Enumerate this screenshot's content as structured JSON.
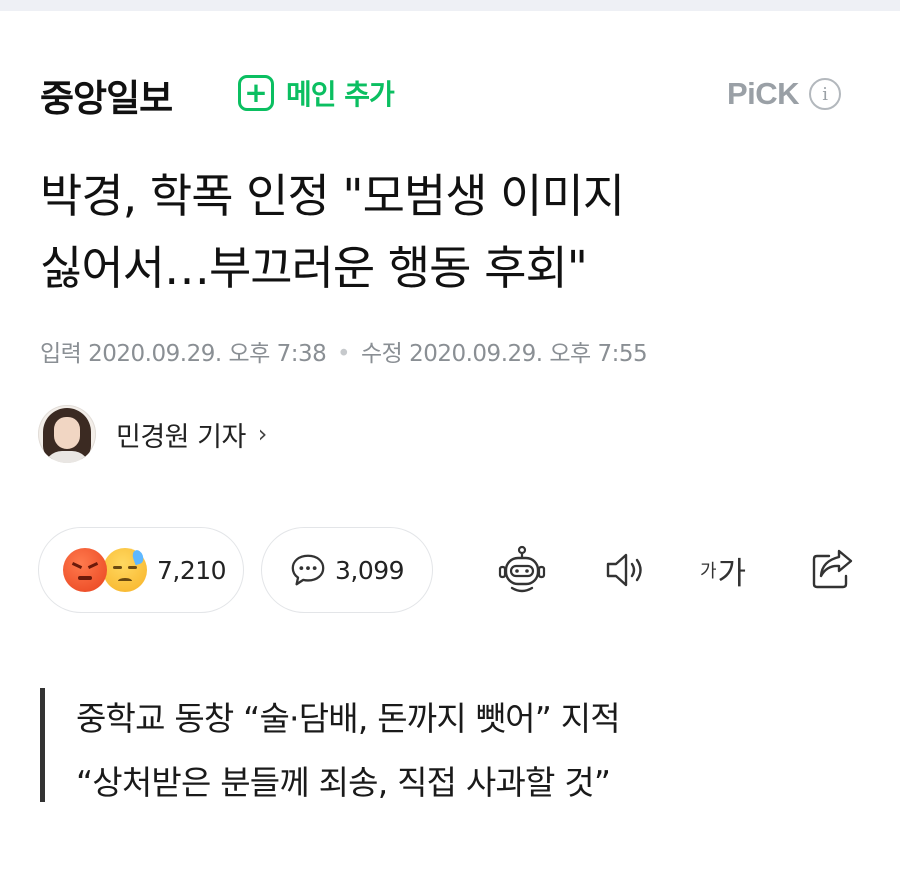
{
  "header": {
    "logo": "중앙일보",
    "add_main_label": "메인 추가",
    "add_main_icon": "plus-icon",
    "pick_label": "PiCK",
    "info_icon_glyph": "i"
  },
  "article": {
    "title_line1": "박경, 학폭 인정 \"모범생 이미지",
    "title_line2": "싫어서…부끄러운 행동 후회\"",
    "input_label": "입력",
    "input_date": "2020.09.29. 오후 7:38",
    "edit_label": "수정",
    "edit_date": "2020.09.29. 오후 7:55",
    "reporter": "민경원 기자",
    "reporter_chevron": "›"
  },
  "actions": {
    "reaction_count": "7,210",
    "comment_count": "3,099",
    "font_small": "가",
    "font_big": "가",
    "icons": [
      "angry-emoji",
      "sad-sweat-emoji",
      "comment-bubble-icon",
      "robot-summary-icon",
      "audio-icon",
      "font-size-icon",
      "share-icon"
    ]
  },
  "summary": {
    "line1": "중학교 동창 “술·담배, 돈까지 뺏어” 지적",
    "line2": "“상처받은 분들께 죄송, 직접 사과할 것”"
  },
  "colors": {
    "brand_green": "#0bbf61",
    "muted_gray": "#8a8f94",
    "text": "#111111"
  }
}
